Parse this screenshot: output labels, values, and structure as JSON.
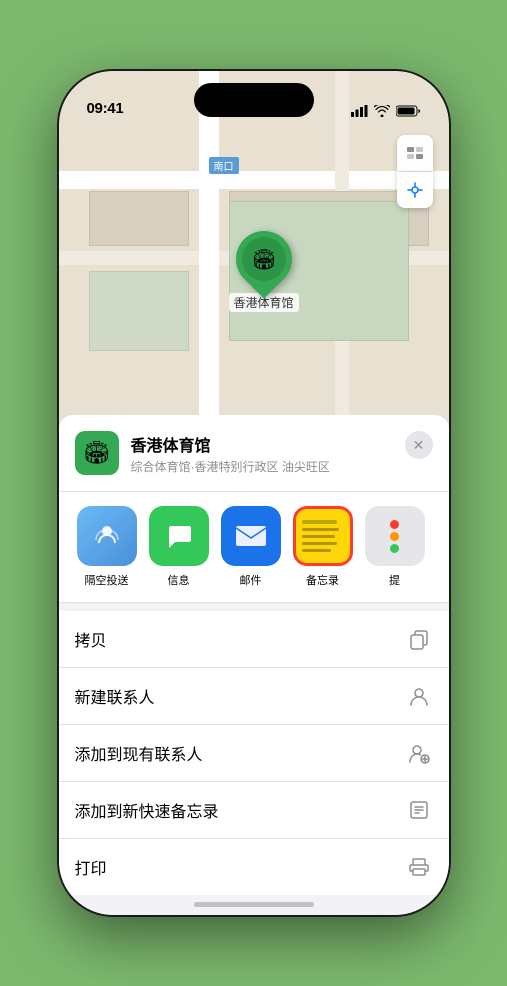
{
  "status_bar": {
    "time": "09:41",
    "location_arrow": "▶"
  },
  "map": {
    "nankou_label": "南口",
    "venue_pin_label": "香港体育馆",
    "venue_pin_emoji": "🏟"
  },
  "map_controls": {
    "map_icon": "🗺",
    "location_icon": "↗"
  },
  "venue_info": {
    "name": "香港体育馆",
    "subtitle": "综合体育馆·香港特别行政区 油尖旺区",
    "logo_emoji": "🏟",
    "close_label": "✕"
  },
  "share_items": [
    {
      "id": "airdrop",
      "label": "隔空投送",
      "type": "airdrop"
    },
    {
      "id": "messages",
      "label": "信息",
      "type": "messages"
    },
    {
      "id": "mail",
      "label": "邮件",
      "type": "mail"
    },
    {
      "id": "notes",
      "label": "备忘录",
      "type": "notes"
    },
    {
      "id": "more",
      "label": "提",
      "type": "more"
    }
  ],
  "action_items": [
    {
      "id": "copy",
      "label": "拷贝",
      "icon": "copy"
    },
    {
      "id": "new-contact",
      "label": "新建联系人",
      "icon": "person"
    },
    {
      "id": "add-existing",
      "label": "添加到现有联系人",
      "icon": "person-add"
    },
    {
      "id": "add-notes",
      "label": "添加到新快速备忘录",
      "icon": "note"
    },
    {
      "id": "print",
      "label": "打印",
      "icon": "print"
    }
  ]
}
